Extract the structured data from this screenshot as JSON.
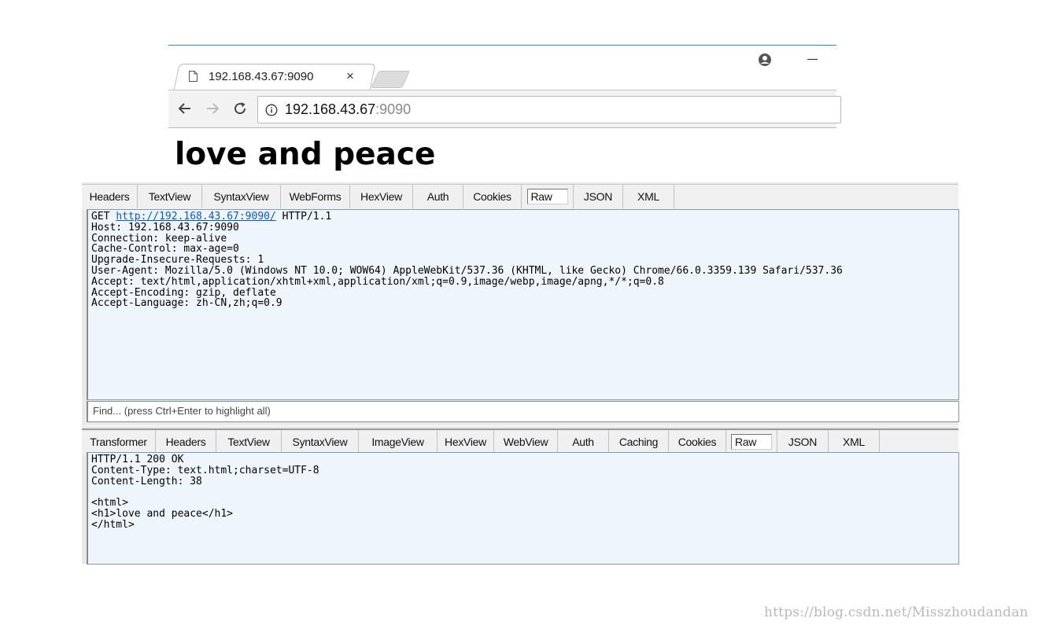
{
  "browser": {
    "tab_title": "192.168.43.67:9090",
    "tab_close": "×",
    "url_host": "192.168.43.67",
    "url_port": ":9090"
  },
  "page": {
    "heading": "love and peace"
  },
  "request": {
    "tabs": [
      "Headers",
      "TextView",
      "SyntaxView",
      "WebForms",
      "HexView",
      "Auth",
      "Cookies",
      "Raw",
      "JSON",
      "XML"
    ],
    "active_tab": "Raw",
    "method": "GET ",
    "link": "http://192.168.43.67:9090/",
    "protocol": " HTTP/1.1",
    "headers": "Host: 192.168.43.67:9090\nConnection: keep-alive\nCache-Control: max-age=0\nUpgrade-Insecure-Requests: 1\nUser-Agent: Mozilla/5.0 (Windows NT 10.0; WOW64) AppleWebKit/537.36 (KHTML, like Gecko) Chrome/66.0.3359.139 Safari/537.36\nAccept: text/html,application/xhtml+xml,application/xml;q=0.9,image/webp,image/apng,*/*;q=0.8\nAccept-Encoding: gzip, deflate\nAccept-Language: zh-CN,zh;q=0.9",
    "find_placeholder": "Find... (press Ctrl+Enter to highlight all)"
  },
  "response": {
    "tabs": [
      "Transformer",
      "Headers",
      "TextView",
      "SyntaxView",
      "ImageView",
      "HexView",
      "WebView",
      "Auth",
      "Caching",
      "Cookies",
      "Raw",
      "JSON",
      "XML"
    ],
    "active_tab": "Raw",
    "raw": "HTTP/1.1 200 OK\nContent-Type: text.html;charset=UTF-8\nContent-Length: 38\n\n<html>\n<h1>love and peace</h1>\n</html>"
  },
  "watermark": "https://blog.csdn.net/Misszhoudandan",
  "colors": {
    "raw_background": "#eef6fc",
    "link": "#0b57c8",
    "chrome_accent": "#3b86c3"
  }
}
